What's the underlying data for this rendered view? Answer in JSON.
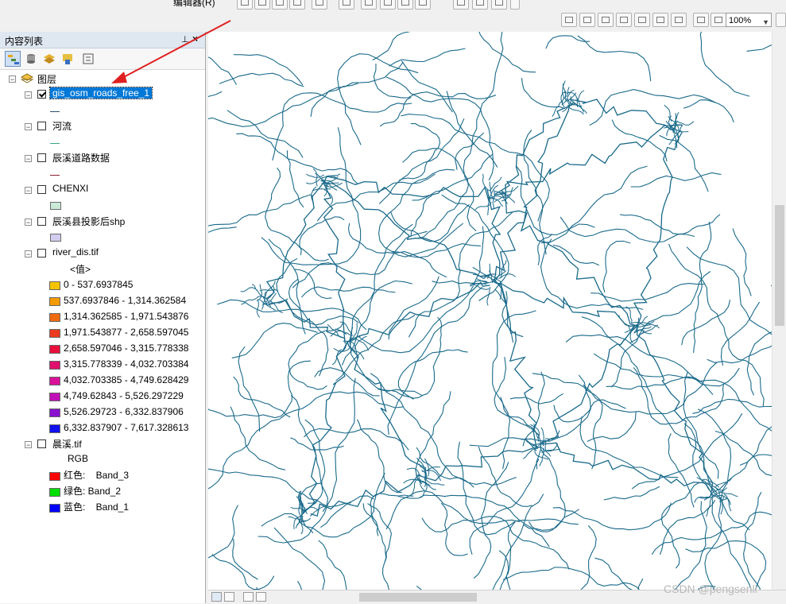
{
  "toolbar": {
    "edit_menu": "编辑器(R)",
    "zoom": "100%"
  },
  "toc": {
    "title": "内容列表",
    "pin_glyph": "⊥",
    "close_glyph": "×",
    "root_label": "图层",
    "layers": [
      {
        "name": "gis_osm_roads_free_1",
        "checked": true,
        "selected": true,
        "symbol": "line",
        "color": "#2f4f6f"
      },
      {
        "name": "河流",
        "checked": false,
        "selected": false,
        "symbol": "line",
        "color": "#3aa58a"
      },
      {
        "name": "辰溪道路数据",
        "checked": false,
        "selected": false,
        "symbol": "line",
        "color": "#8a2030"
      },
      {
        "name": "CHENXI",
        "checked": false,
        "selected": false,
        "symbol": "box",
        "color": "#c9ebd6"
      },
      {
        "name": "辰溪县投影后shp",
        "checked": false,
        "selected": false,
        "symbol": "box",
        "color": "#d2cdf0"
      },
      {
        "name": "river_dis.tif",
        "checked": false,
        "selected": false,
        "symbol": "ramp"
      },
      {
        "name": "晨溪.tif",
        "checked": false,
        "selected": false,
        "symbol": "rgb"
      }
    ],
    "value_header": "<值>",
    "ramp": [
      {
        "label": "0 - 537.6937845",
        "color": "#f5c400"
      },
      {
        "label": "537.6937846 - 1,314.362584",
        "color": "#f59b00"
      },
      {
        "label": "1,314.362585 - 1,971.543876",
        "color": "#f06a10"
      },
      {
        "label": "1,971.543877 - 2,658.597045",
        "color": "#ec3a20"
      },
      {
        "label": "2,658.597046 - 3,315.778338",
        "color": "#e8103a"
      },
      {
        "label": "3,315.778339 - 4,032.703384",
        "color": "#e0106e"
      },
      {
        "label": "4,032.703385 - 4,749.628429",
        "color": "#d8109a"
      },
      {
        "label": "4,749.62843 - 5,526.297229",
        "color": "#c010b8"
      },
      {
        "label": "5,526.29723 - 6,332.837906",
        "color": "#8a10d0"
      },
      {
        "label": "6,332.837907 - 7,617.328613",
        "color": "#1010f0"
      }
    ],
    "rgb_header": "RGB",
    "rgb": [
      {
        "label": "红色:    Band_3",
        "color": "#ff0000"
      },
      {
        "label": "绿色: Band_2",
        "color": "#00e000"
      },
      {
        "label": "蓝色:    Band_1",
        "color": "#0000ff"
      }
    ]
  },
  "map": {
    "road_color": "#1a6a8a"
  },
  "watermark": "CSDN @pengsenli"
}
